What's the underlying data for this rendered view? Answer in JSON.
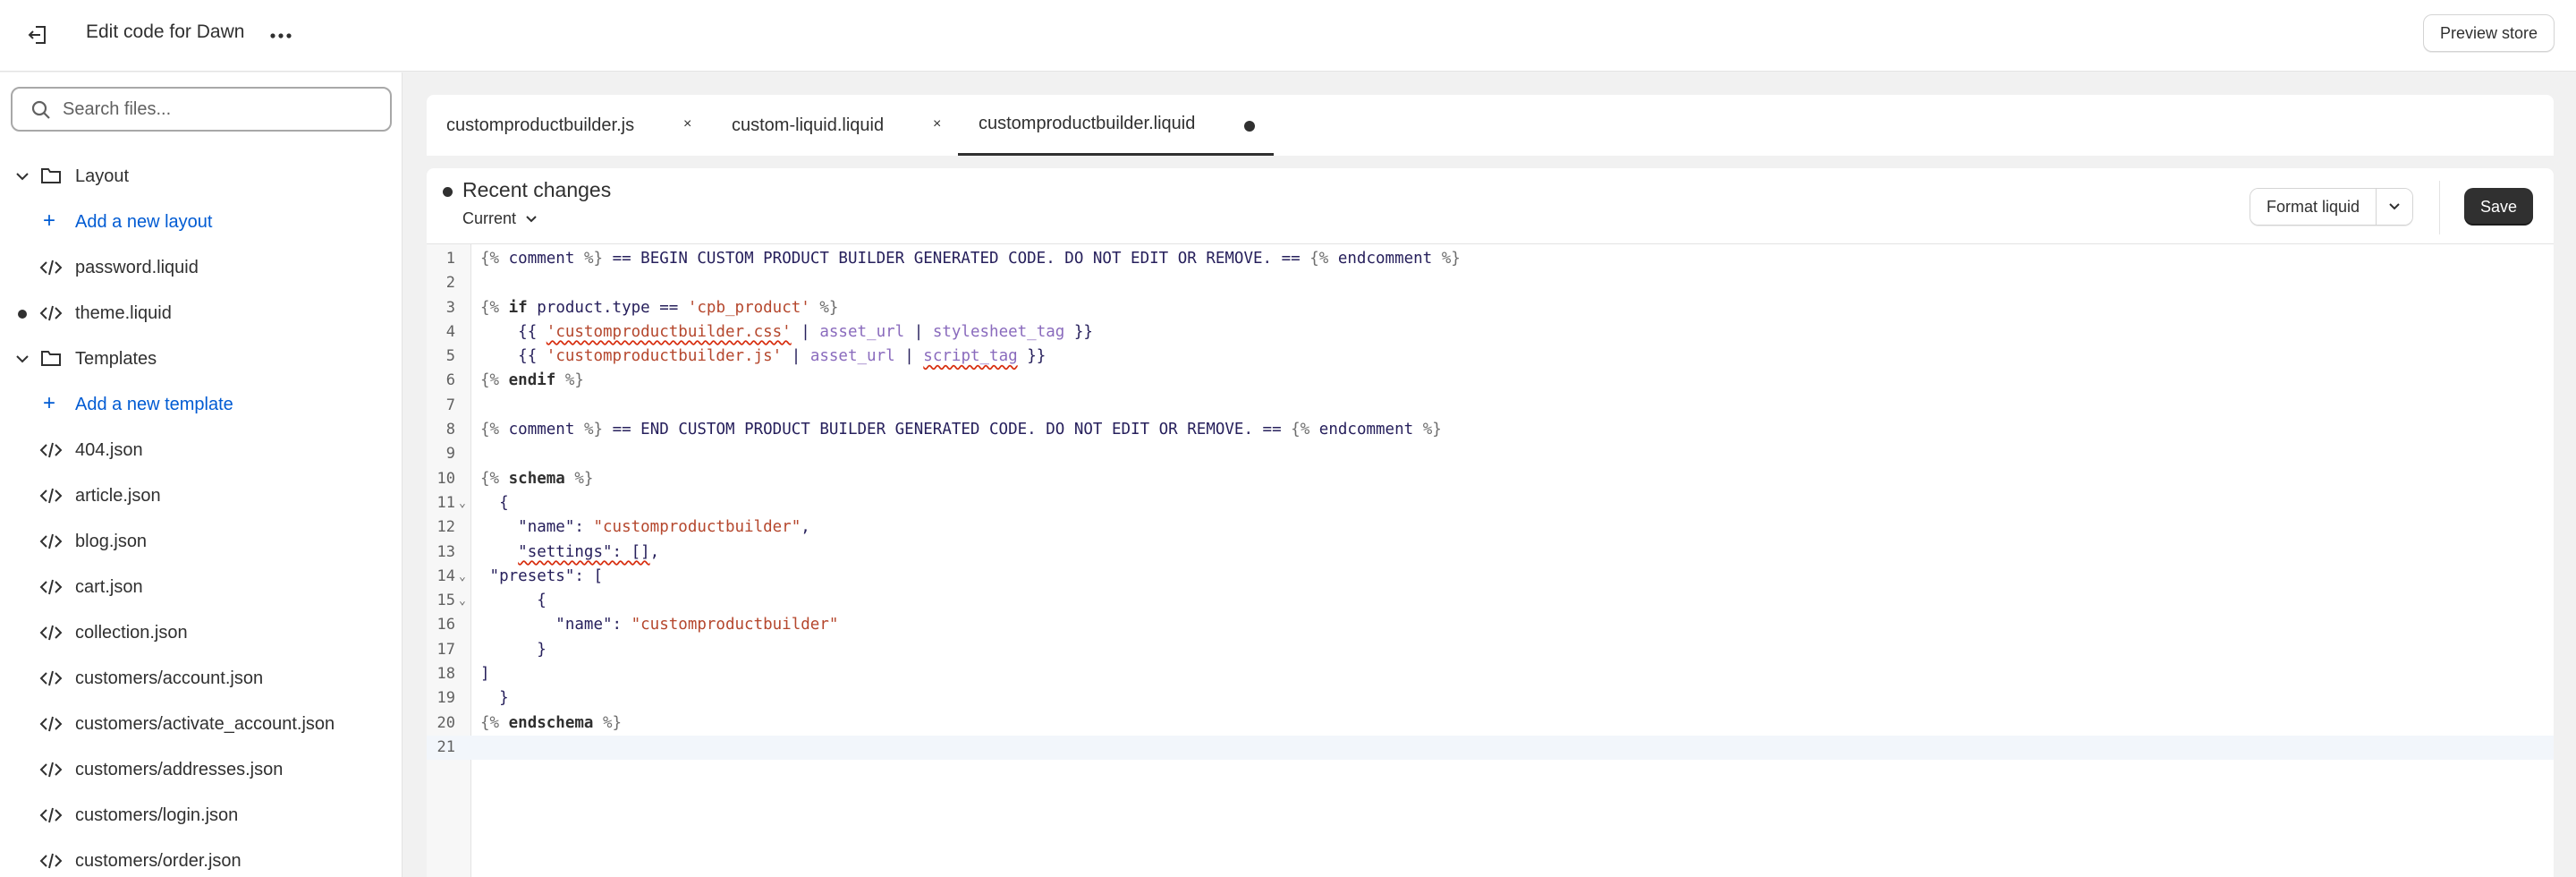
{
  "topbar": {
    "title": "Edit code for Dawn",
    "preview_label": "Preview store"
  },
  "sidebar": {
    "search_placeholder": "Search files...",
    "items": [
      {
        "type": "folder",
        "label": "Layout",
        "expanded": true
      },
      {
        "type": "add",
        "label": "Add a new layout"
      },
      {
        "type": "file",
        "label": "password.liquid"
      },
      {
        "type": "file",
        "label": "theme.liquid",
        "modified": true
      },
      {
        "type": "folder",
        "label": "Templates",
        "expanded": true
      },
      {
        "type": "add",
        "label": "Add a new template"
      },
      {
        "type": "file",
        "label": "404.json"
      },
      {
        "type": "file",
        "label": "article.json"
      },
      {
        "type": "file",
        "label": "blog.json"
      },
      {
        "type": "file",
        "label": "cart.json"
      },
      {
        "type": "file",
        "label": "collection.json"
      },
      {
        "type": "file",
        "label": "customers/account.json"
      },
      {
        "type": "file",
        "label": "customers/activate_account.json"
      },
      {
        "type": "file",
        "label": "customers/addresses.json"
      },
      {
        "type": "file",
        "label": "customers/login.json"
      },
      {
        "type": "file",
        "label": "customers/order.json"
      }
    ]
  },
  "tabs": [
    {
      "label": "customproductbuilder.js",
      "close": "×"
    },
    {
      "label": "custom-liquid.liquid",
      "close": "×"
    },
    {
      "label": "customproductbuilder.liquid",
      "active": true,
      "unsaved": true
    }
  ],
  "editor": {
    "recent_title": "Recent changes",
    "version_label": "Current",
    "format_label": "Format liquid",
    "save_label": "Save",
    "active_line": 21,
    "lines": [
      {
        "n": "1",
        "fold": "",
        "html": "<span class=\"dl\">{%</span> <span class=\"vr\">comment</span> <span class=\"dl\">%}</span> <span class=\"vr\">== BEGIN CUSTOM PRODUCT BUILDER GENERATED CODE. DO NOT EDIT OR REMOVE. ==</span> <span class=\"dl\">{%</span> <span class=\"vr\">endcomment</span> <span class=\"dl\">%}</span>"
      },
      {
        "n": "2",
        "fold": "",
        "html": ""
      },
      {
        "n": "3",
        "fold": "",
        "html": "<span class=\"dl\">{%</span> <span class=\"kw\">if</span> <span class=\"vr\">product.type</span> <span class=\"vr\">==</span> <span class=\"st\">'cpb_product'</span> <span class=\"dl\">%}</span>"
      },
      {
        "n": "4",
        "fold": "",
        "html": "    <span class=\"vr\">{{</span> <span class=\"st sq\">'customproductbuilder.css'</span> <span class=\"vr\">|</span> <span class=\"fl\">asset_url</span> <span class=\"vr\">|</span> <span class=\"fl\">stylesheet_tag</span> <span class=\"vr\">}}</span>"
      },
      {
        "n": "5",
        "fold": "",
        "html": "    <span class=\"vr\">{{</span> <span class=\"st\">'customproductbuilder.js'</span> <span class=\"vr\">|</span> <span class=\"fl\">asset_url</span> <span class=\"vr\">|</span> <span class=\"fl sq\">script_tag</span> <span class=\"vr\">}}</span>"
      },
      {
        "n": "6",
        "fold": "",
        "html": "<span class=\"dl\">{%</span> <span class=\"kw\">endif</span> <span class=\"dl\">%}</span>"
      },
      {
        "n": "7",
        "fold": "",
        "html": ""
      },
      {
        "n": "8",
        "fold": "",
        "html": "<span class=\"dl\">{%</span> <span class=\"vr\">comment</span> <span class=\"dl\">%}</span> <span class=\"vr\">== END CUSTOM PRODUCT BUILDER GENERATED CODE. DO NOT EDIT OR REMOVE. ==</span> <span class=\"dl\">{%</span> <span class=\"vr\">endcomment</span> <span class=\"dl\">%}</span>"
      },
      {
        "n": "9",
        "fold": "",
        "html": ""
      },
      {
        "n": "10",
        "fold": "",
        "html": "<span class=\"dl\">{%</span> <span class=\"kw\">schema</span> <span class=\"dl\">%}</span>"
      },
      {
        "n": "11",
        "fold": "⌄",
        "html": "  <span class=\"vr\">{</span>"
      },
      {
        "n": "12",
        "fold": "",
        "html": "    <span class=\"vr\">\"name\"</span><span class=\"vr\">:</span> <span class=\"st\">\"customproductbuilder\"</span><span class=\"vr\">,</span>"
      },
      {
        "n": "13",
        "fold": "",
        "html": "    <span class=\"vr sq\">\"settings\": []</span><span class=\"vr\">,</span>"
      },
      {
        "n": "14",
        "fold": "⌄",
        "html": " <span class=\"vr\">\"presets\"</span><span class=\"vr\">: [</span>"
      },
      {
        "n": "15",
        "fold": "⌄",
        "html": "      <span class=\"vr\">{</span>"
      },
      {
        "n": "16",
        "fold": "",
        "html": "        <span class=\"vr\">\"name\"</span><span class=\"vr\">:</span> <span class=\"st\">\"customproductbuilder\"</span>"
      },
      {
        "n": "17",
        "fold": "",
        "html": "      <span class=\"vr\">}</span>"
      },
      {
        "n": "18",
        "fold": "",
        "html": "<span class=\"vr\">]</span>"
      },
      {
        "n": "19",
        "fold": "",
        "html": "  <span class=\"vr\">}</span>"
      },
      {
        "n": "20",
        "fold": "",
        "html": "<span class=\"dl\">{%</span> <span class=\"kw\">endschema</span> <span class=\"dl\">%}</span>"
      },
      {
        "n": "21",
        "fold": "",
        "html": ""
      }
    ]
  },
  "colors": {
    "link": "#005bd3",
    "primary_button": "#303030",
    "string": "#b5472d",
    "filter": "#8a6bbd"
  }
}
